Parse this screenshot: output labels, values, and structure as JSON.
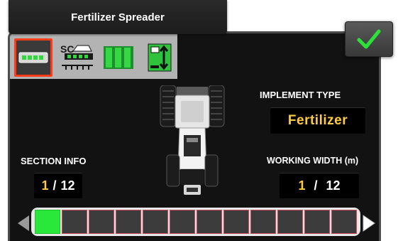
{
  "title": "Fertilizer Spreader",
  "toolbar": {
    "buttons": [
      {
        "name": "implement-view",
        "active": true
      },
      {
        "name": "section-control",
        "label": "SC",
        "active": false
      },
      {
        "name": "sections-view",
        "active": false
      },
      {
        "name": "height-adjust",
        "active": false
      }
    ]
  },
  "confirm": {
    "icon": "checkmark-icon",
    "color": "#2ee03a"
  },
  "implement_type": {
    "label": "IMPLEMENT TYPE",
    "value": "Fertilizer"
  },
  "section_info": {
    "label": "SECTION INFO",
    "current": "1",
    "separator": "/",
    "total": "12"
  },
  "working_width": {
    "label": "WORKING WIDTH (m)",
    "current": "1",
    "separator": "/",
    "total": "12"
  },
  "sections": {
    "count": 12,
    "active": [
      1
    ]
  },
  "colors": {
    "accent": "#ffcc3d",
    "active_section": "#29e83a",
    "selected_border": "#ff3b18"
  }
}
